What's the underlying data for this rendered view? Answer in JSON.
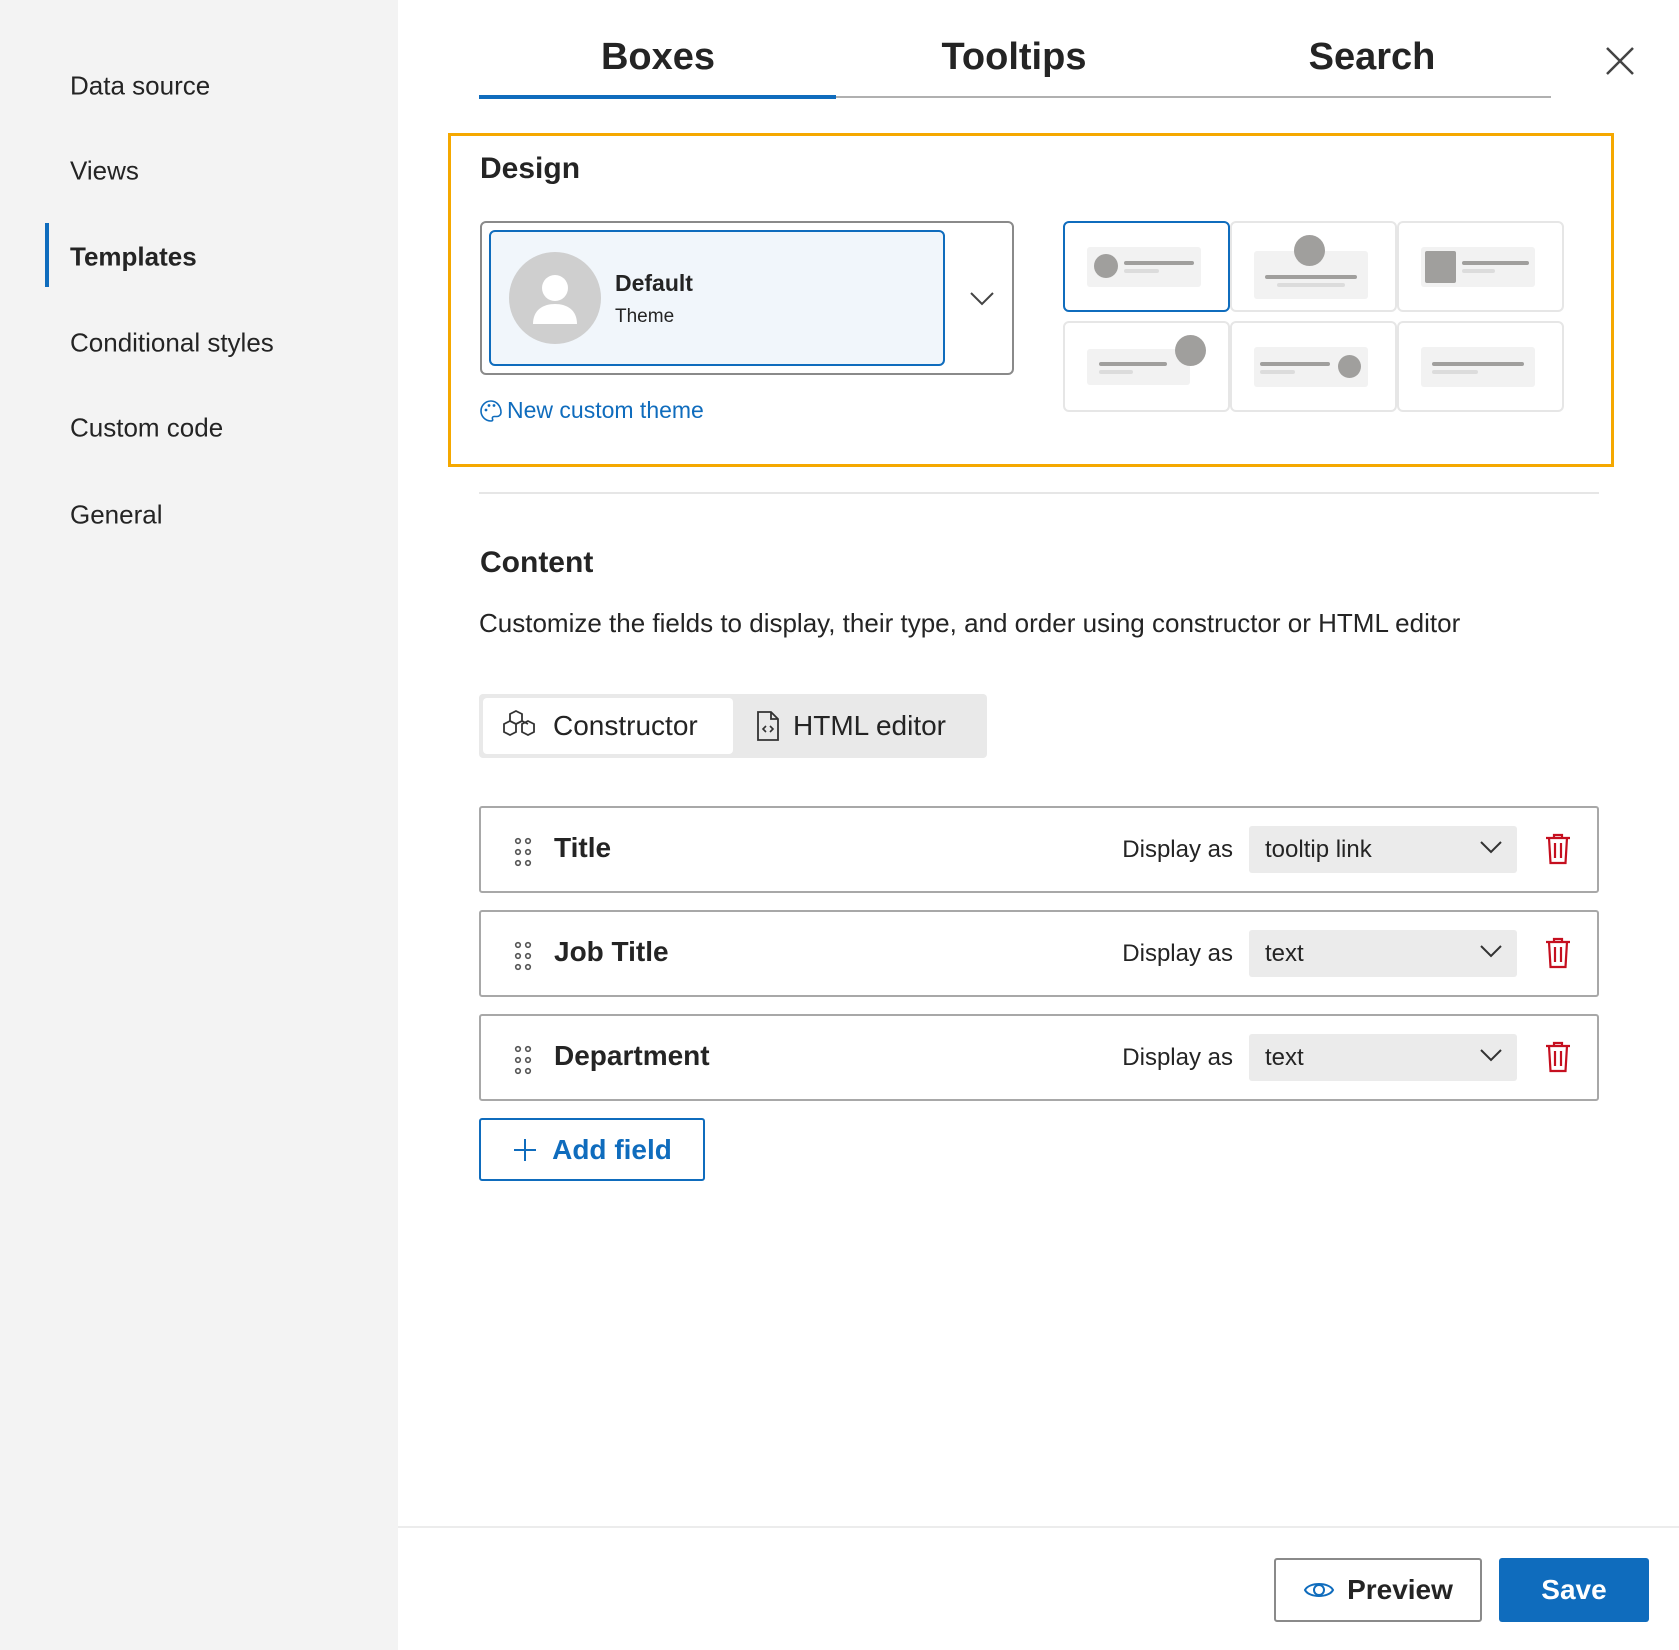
{
  "sidebar": {
    "items": [
      {
        "label": "Data source"
      },
      {
        "label": "Views"
      },
      {
        "label": "Templates",
        "active": true
      },
      {
        "label": "Conditional styles"
      },
      {
        "label": "Custom code"
      },
      {
        "label": "General"
      }
    ]
  },
  "tabs": [
    {
      "label": "Boxes",
      "active": true
    },
    {
      "label": "Tooltips"
    },
    {
      "label": "Search"
    }
  ],
  "design": {
    "heading": "Design",
    "theme": {
      "name": "Default",
      "subtitle": "Theme"
    },
    "new_theme_link": "New custom theme",
    "selected_layout": 1
  },
  "content": {
    "heading": "Content",
    "description": "Customize the fields to display, their type, and order using constructor or HTML editor",
    "modes": {
      "constructor": "Constructor",
      "html_editor": "HTML editor"
    },
    "display_as_label": "Display as",
    "fields": [
      {
        "name": "Title",
        "display_as": "tooltip link"
      },
      {
        "name": "Job Title",
        "display_as": "text"
      },
      {
        "name": "Department",
        "display_as": "text"
      }
    ],
    "add_field": "Add field"
  },
  "footer": {
    "preview": "Preview",
    "save": "Save"
  },
  "colors": {
    "accent": "#0f6cbd",
    "highlight": "#f5a800",
    "danger": "#c50f1f"
  }
}
